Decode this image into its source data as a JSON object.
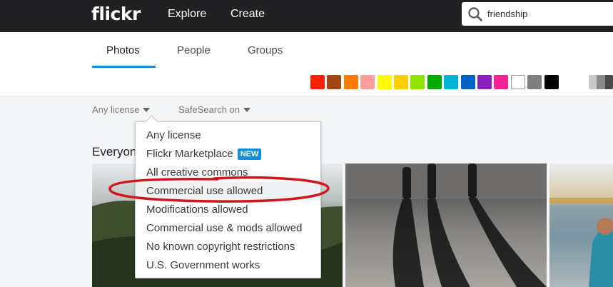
{
  "header": {
    "logo": "flickr",
    "nav": [
      {
        "label": "Explore"
      },
      {
        "label": "Create"
      }
    ],
    "search": {
      "value": "friendship"
    }
  },
  "tabs": [
    {
      "label": "Photos",
      "active": true
    },
    {
      "label": "People",
      "active": false
    },
    {
      "label": "Groups",
      "active": false
    }
  ],
  "color_filters": [
    "#ff2000",
    "#a24615",
    "#ff7c00",
    "#ff9f9c",
    "#fffa00",
    "#ffcf00",
    "#90e200",
    "#00ab00",
    "#00b2d4",
    "#0062c6",
    "#8c20ba",
    "#f52394",
    "#ffffff",
    "#7e7e7e",
    "#000000"
  ],
  "filters": {
    "license_label": "Any license",
    "safesearch_label": "SafeSearch on"
  },
  "section_title": "Everyone's photos",
  "license_menu": {
    "items": [
      {
        "label": "Any license"
      },
      {
        "label": "Flickr Marketplace",
        "badge": "NEW"
      },
      {
        "label": "All creative commons"
      },
      {
        "label": "Commercial use allowed",
        "highlighted": true
      },
      {
        "label": "Modifications allowed"
      },
      {
        "label": "Commercial use & mods allowed"
      },
      {
        "label": "No known copyright restrictions"
      },
      {
        "label": "U.S. Government works"
      }
    ]
  },
  "annotation_color": "#d0161c",
  "accent_color": "#128fdc"
}
